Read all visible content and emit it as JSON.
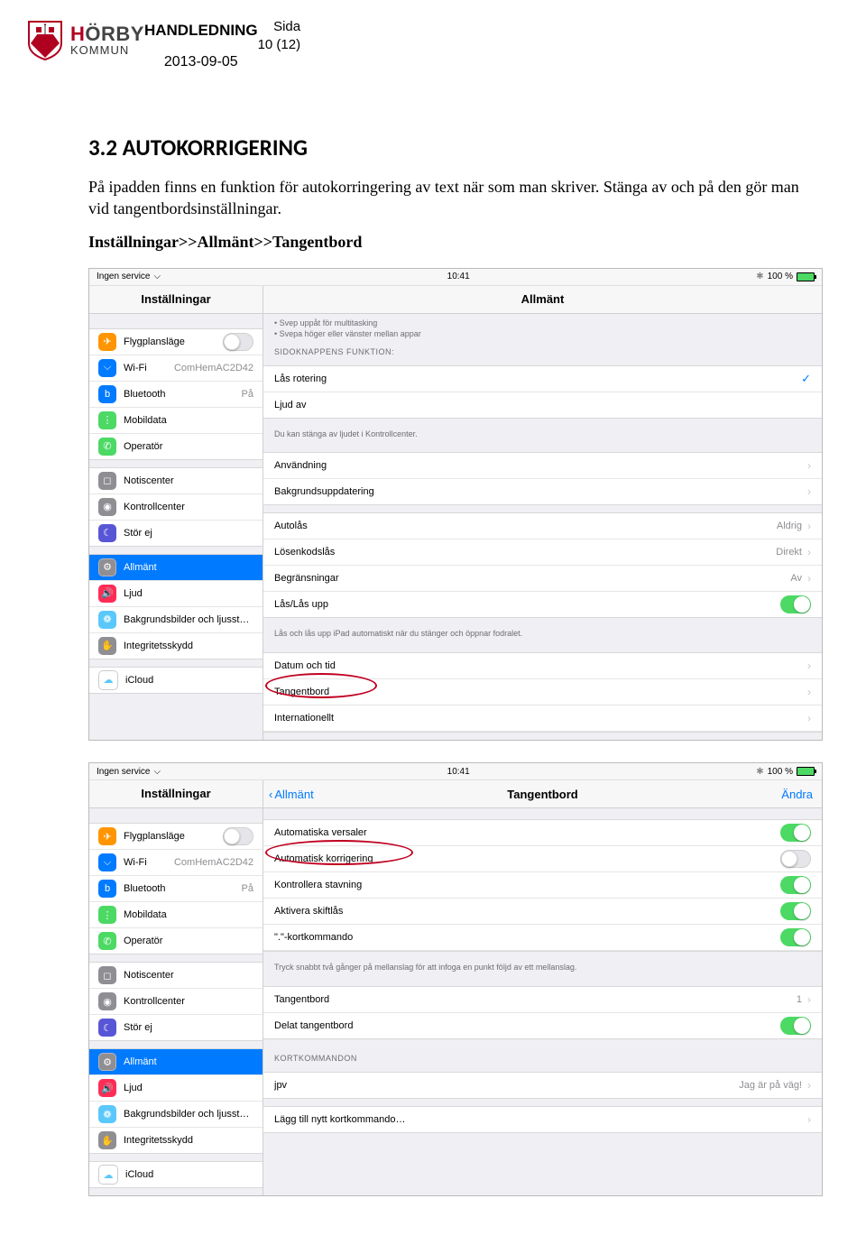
{
  "logo": {
    "brand_h": "H",
    "brand_o": "Ö",
    "brand_rest": "RBY",
    "sub": "KOMMUN"
  },
  "doc": {
    "title": "HANDLEDNING",
    "date": "2013-09-05",
    "sida_label": "Sida",
    "page_no": "10 (12)",
    "section_title": "3.2   AUTOKORRIGERING",
    "para1": "På ipadden finns en funktion för autokorringering av text när som man skriver. Stänga av och på den gör man vid tangentbordsinställningar.",
    "nav_path": "Inställningar>>Allmänt>>Tangentbord"
  },
  "status": {
    "carrier": "Ingen service",
    "time": "10:41",
    "batt": "100 %"
  },
  "sidebar_titles": {
    "settings": "Inställningar"
  },
  "back": {
    "allmant": "Allmänt"
  },
  "titles": {
    "allmant": "Allmänt",
    "tangentbord": "Tangentbord",
    "andra": "Ändra"
  },
  "side": {
    "flyg": "Flygplansläge",
    "wifi": "Wi-Fi",
    "wifi_val": "ComHemAC2D42",
    "bt": "Bluetooth",
    "bt_val": "På",
    "mobil": "Mobildata",
    "op": "Operatör",
    "notis": "Notiscenter",
    "kontroll": "Kontrollcenter",
    "stor": "Stör ej",
    "allmant": "Allmänt",
    "ljud": "Ljud",
    "bakgrund": "Bakgrundsbilder och ljusst…",
    "integritet": "Integritetsskydd",
    "icloud": "iCloud"
  },
  "allmant_detail": {
    "hint_top1": "• Svep uppåt för multitasking",
    "hint_top2": "• Svepa höger eller vänster mellan appar",
    "header1": "SIDOKNAPPENS FUNKTION:",
    "lasrot": "Lås rotering",
    "ljudav": "Ljud av",
    "hint_kontroll": "Du kan stänga av ljudet i Kontrollcenter.",
    "anvandning": "Användning",
    "bakgrundupp": "Bakgrundsuppdatering",
    "autolas": "Autolås",
    "autolas_val": "Aldrig",
    "losenkod": "Lösenkodslås",
    "losenkod_val": "Direkt",
    "begrans": "Begränsningar",
    "begrans_val": "Av",
    "laslas": "Lås/Lås upp",
    "hint_laslas": "Lås och lås upp iPad automatiskt när du stänger och öppnar fodralet.",
    "datum": "Datum och tid",
    "tangent": "Tangentbord",
    "inter": "Internationellt"
  },
  "tangent_detail": {
    "auto_versaler": "Automatiska versaler",
    "auto_korr": "Automatisk korrigering",
    "kontroll_stav": "Kontrollera stavning",
    "aktivera_skift": "Aktivera skiftlås",
    "kort": "\".\"-kortkommando",
    "hint_kort": "Tryck snabbt två gånger på mellanslag för att infoga en punkt följd av ett mellanslag.",
    "tangentbord": "Tangentbord",
    "tangentbord_val": "1",
    "delat": "Delat tangentbord",
    "header_kort": "KORTKOMMANDON",
    "jpv": "jpv",
    "jpv_val": "Jag är på väg!",
    "lagg": "Lägg till nytt kortkommando…"
  }
}
